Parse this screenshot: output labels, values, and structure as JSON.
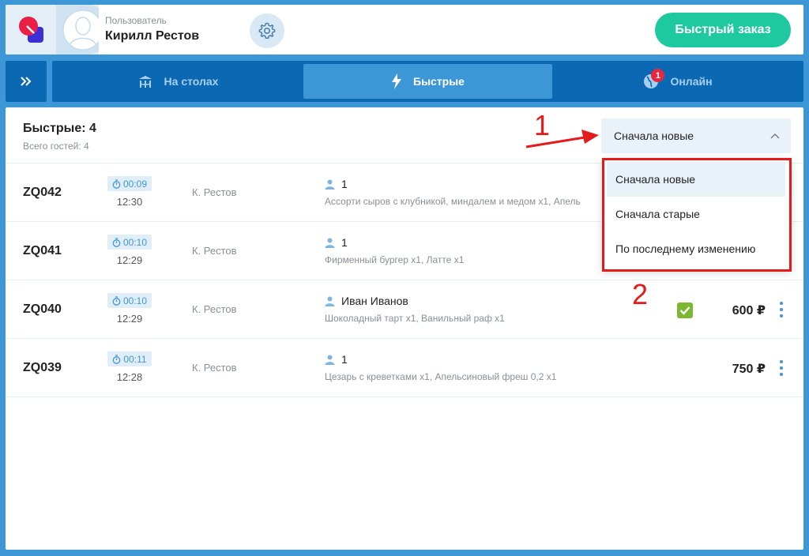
{
  "header": {
    "user_label": "Пользователь",
    "user_name": "Кирилл Рестов",
    "quick_order_label": "Быстрый заказ"
  },
  "nav": {
    "tabs": [
      {
        "label": "На столах",
        "icon": "tables-icon",
        "active": false
      },
      {
        "label": "Быстрые",
        "icon": "lightning-icon",
        "active": true
      },
      {
        "label": "Онлайн",
        "icon": "globe-icon",
        "active": false,
        "badge": "1"
      }
    ]
  },
  "list": {
    "title": "Быстрые: 4",
    "subtitle": "Всего гостей: 4"
  },
  "sort": {
    "selected": "Сначала новые",
    "options": [
      "Сначала новые",
      "Сначала старые",
      "По последнему изменению"
    ]
  },
  "orders": [
    {
      "id": "ZQ042",
      "timer": "00:09",
      "time": "12:30",
      "waiter": "К. Рестов",
      "guest": "1",
      "items": "Ассорти сыров с клубникой, миндалем и медом x1, Апель",
      "checked": false,
      "price": ""
    },
    {
      "id": "ZQ041",
      "timer": "00:10",
      "time": "12:29",
      "waiter": "К. Рестов",
      "guest": "1",
      "items": "Фирменный бургер x1, Латте x1",
      "checked": false,
      "price": ""
    },
    {
      "id": "ZQ040",
      "timer": "00:10",
      "time": "12:29",
      "waiter": "К. Рестов",
      "guest": "Иван Иванов",
      "items": "Шоколадный тарт x1, Ванильный раф x1",
      "checked": true,
      "price": "600 ₽"
    },
    {
      "id": "ZQ039",
      "timer": "00:11",
      "time": "12:28",
      "waiter": "К. Рестов",
      "guest": "1",
      "items": "Цезарь с креветками x1, Апельсиновый фреш 0,2 x1",
      "checked": false,
      "price": "750 ₽"
    }
  ],
  "annotations": {
    "first": "1",
    "second": "2"
  },
  "colors": {
    "accent": "#3d97d6",
    "nav": "#0b69b3",
    "quick_order": "#1ec9a0",
    "annotation": "#e41b1b",
    "check": "#7cb730"
  }
}
